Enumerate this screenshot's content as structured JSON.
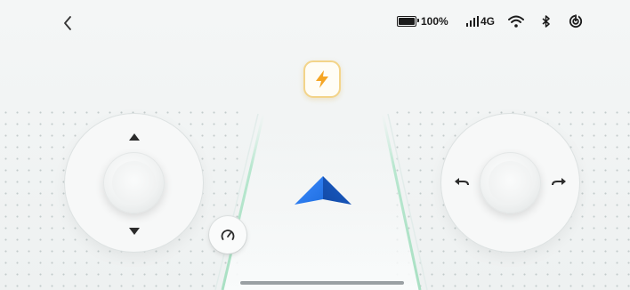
{
  "status_bar": {
    "battery_percent": "100%",
    "network_type": "4G",
    "icons": [
      "battery-icon",
      "signal-icon",
      "wifi-icon",
      "bluetooth-icon",
      "hotspot-icon"
    ]
  },
  "navigation": {
    "back_icon": "chevron-left-icon"
  },
  "mode_badge": {
    "icon": "lightning-bolt-icon",
    "accent": "#f5a524"
  },
  "left_joystick": {
    "icons": [
      "arrow-up-icon",
      "arrow-down-icon"
    ]
  },
  "right_joystick": {
    "icons": [
      "arrow-left-icon",
      "arrow-right-icon"
    ]
  },
  "speed_button": {
    "icon": "speedometer-icon"
  },
  "direction_indicator": {
    "icon": "navigation-arrow-icon",
    "color": "#1f6fe0"
  }
}
